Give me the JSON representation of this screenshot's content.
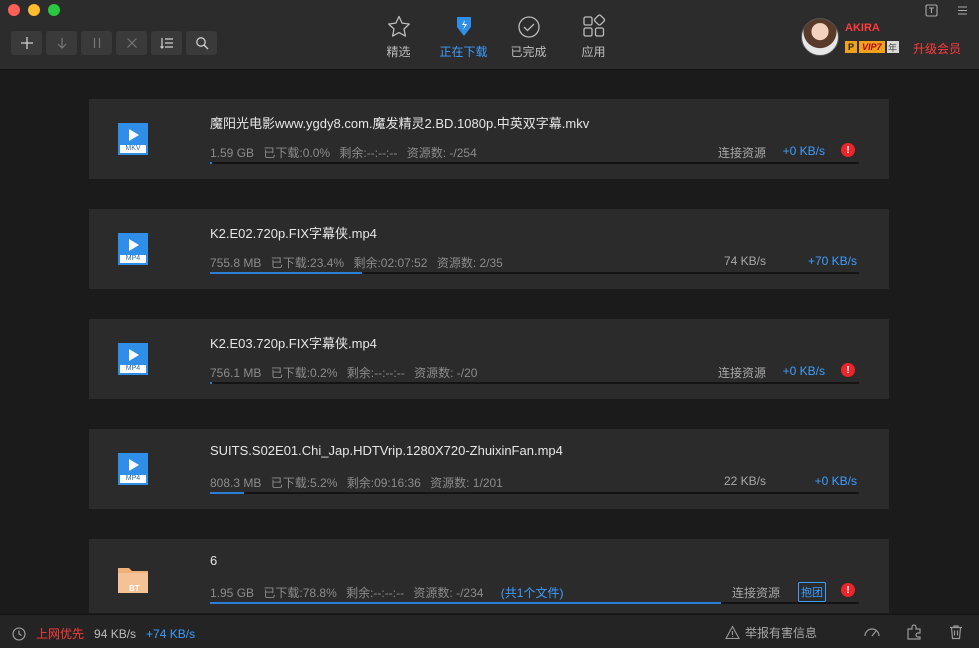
{
  "toolbar": {
    "buttons": [
      "add-icon",
      "download-icon",
      "pause-icon",
      "close-icon",
      "sort-icon",
      "search-icon"
    ]
  },
  "tabs": [
    {
      "label": "精选",
      "icon": "star-icon"
    },
    {
      "label": "正在下载",
      "icon": "downloading-icon"
    },
    {
      "label": "已完成",
      "icon": "check-circle-icon"
    },
    {
      "label": "应用",
      "icon": "apps-icon"
    }
  ],
  "user": {
    "name": "AKIRA",
    "badge_p": "P",
    "badge_vip": "VIP7",
    "badge_year": "年",
    "upgrade": "升级会员"
  },
  "downloads": [
    {
      "type": "MKV",
      "name": "魔阳光电影www.ygdy8.com.魔发精灵2.BD.1080p.中英双字幕.mkv",
      "size": "1.59 GB",
      "downloaded": "已下载:0.0%",
      "remaining": "剩余:--:--:--",
      "sources": "资源数: -/254",
      "status": "连接资源",
      "speed": "+0 KB/s",
      "progress": 0.0,
      "warning": true
    },
    {
      "type": "MP4",
      "name": "K2.E02.720p.FIX字幕侠.mp4",
      "size": "755.8 MB",
      "downloaded": "已下载:23.4%",
      "remaining": "剩余:02:07:52",
      "sources": "资源数: 2/35",
      "status": "74 KB/s",
      "speed": "+70 KB/s",
      "progress": 0.234,
      "warning": false
    },
    {
      "type": "MP4",
      "name": "K2.E03.720p.FIX字幕侠.mp4",
      "size": "756.1 MB",
      "downloaded": "已下载:0.2%",
      "remaining": "剩余:--:--:--",
      "sources": "资源数: -/20",
      "status": "连接资源",
      "speed": "+0 KB/s",
      "progress": 0.002,
      "warning": true
    },
    {
      "type": "MP4",
      "name": "SUITS.S02E01.Chi_Jap.HDTVrip.1280X720-ZhuixinFan.mp4",
      "size": "808.3 MB",
      "downloaded": "已下载:5.2%",
      "remaining": "剩余:09:16:36",
      "sources": "资源数: 1/201",
      "status": "22 KB/s",
      "speed": "+0 KB/s",
      "progress": 0.052,
      "warning": false
    },
    {
      "type": "BT",
      "name": "6",
      "size": "1.95 GB",
      "downloaded": "已下载:78.8%",
      "remaining": "剩余:--:--:--",
      "sources": "资源数: -/234",
      "extra": "(共1个文件)",
      "status": "连接资源",
      "tag": "抱团",
      "progress": 0.788,
      "warning": true
    }
  ],
  "statusbar": {
    "mode": "上网优先",
    "down": "94 KB/s",
    "up": "+74 KB/s",
    "report": "举报有害信息"
  },
  "colors": {
    "accent": "#3d9eff",
    "danger": "#ff3b3b",
    "bg": "#1b1b1b",
    "card": "#2b2b2b"
  }
}
